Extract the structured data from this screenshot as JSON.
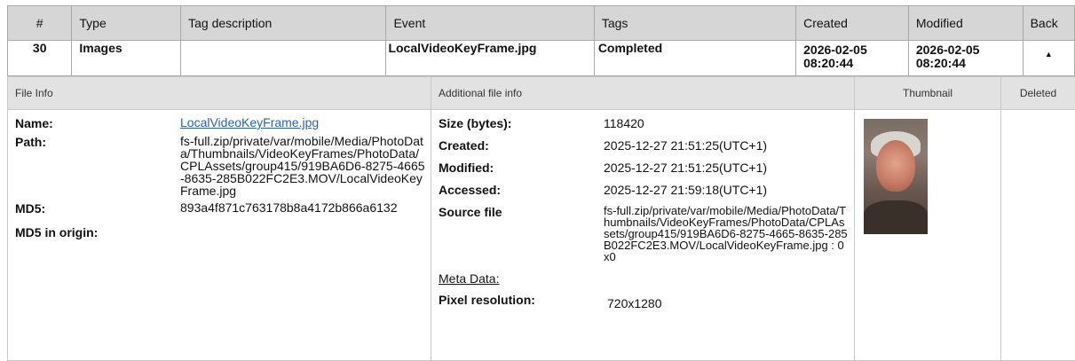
{
  "grid": {
    "headers": [
      "#",
      "Type",
      "Tag description",
      "Event",
      "Tags",
      "Created",
      "Modified",
      "Back"
    ],
    "row": {
      "num": "30",
      "type": "Images",
      "tag_description": "",
      "event": "LocalVideoKeyFrame.jpg",
      "tags": "Completed",
      "created_date": "2026-02-05",
      "created_time": "08:20:44",
      "modified_date": "2026-02-05",
      "modified_time": "08:20:44",
      "back_icon": "up-arrow-icon"
    }
  },
  "detail_headers": {
    "file_info": "File Info",
    "additional": "Additional file info",
    "thumbnail": "Thumbnail",
    "deleted": "Deleted"
  },
  "file_info": {
    "name_label": "Name:",
    "name_value": "LocalVideoKeyFrame.jpg",
    "path_label": "Path:",
    "path_value": "fs-full.zip/private/var/mobile/Media/PhotoData/Thumbnails/VideoKeyFrames/PhotoData/CPLAssets/group415/919BA6D6-8275-4665-8635-285B022FC2E3.MOV/LocalVideoKeyFrame.jpg",
    "md5_label": "MD5:",
    "md5_value": "893a4f871c763178b8a4172b866a6132",
    "md5_origin_label": "MD5 in origin:"
  },
  "additional_info": {
    "size_label": "Size (bytes):",
    "size_value": "118420",
    "created_label": "Created:",
    "created_value": "2025-12-27 21:51:25(UTC+1)",
    "modified_label": "Modified:",
    "modified_value": "2025-12-27 21:51:25(UTC+1)",
    "accessed_label": "Accessed:",
    "accessed_value": "2025-12-27 21:59:18(UTC+1)",
    "source_label": "Source file",
    "source_value": "fs-full.zip/private/var/mobile/Media/PhotoData/Thumbnails/VideoKeyFrames/PhotoData/CPLAssets/group415/919BA6D6-8275-4665-8635-285B022FC2E3.MOV/LocalVideoKeyFrame.jpg : 0x0",
    "meta_label": "Meta Data:",
    "pixel_label": "Pixel resolution:",
    "pixel_value": "720x1280"
  }
}
